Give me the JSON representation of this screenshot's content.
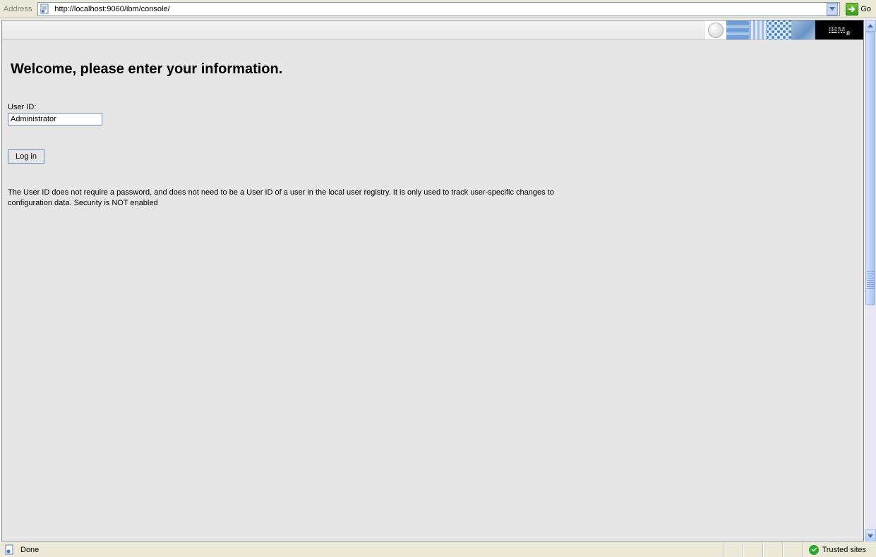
{
  "address_bar": {
    "label": "Address",
    "url": "http://localhost:9060/ibm/console/",
    "go_label": "Go"
  },
  "banner": {
    "logo_text": "IBM"
  },
  "login": {
    "heading": "Welcome, please enter your information.",
    "user_id_label": "User ID:",
    "user_id_value": "Administrator",
    "login_button_label": "Log in",
    "info_text": "The User ID does not require a password, and does not need to be a User ID of a user in the local user registry. It is only used to track user-specific changes to configuration data. Security is NOT enabled"
  },
  "status_bar": {
    "status_text": "Done",
    "zone_text": "Trusted sites"
  }
}
